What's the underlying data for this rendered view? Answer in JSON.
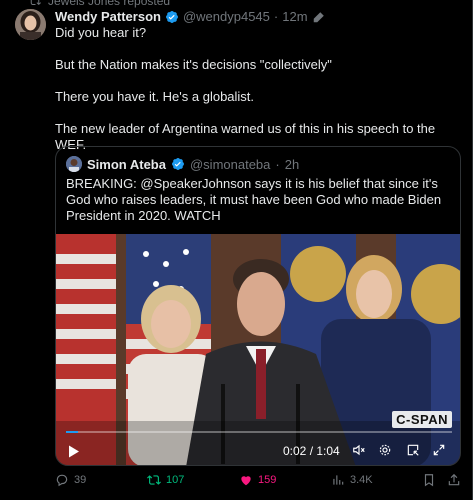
{
  "repost": {
    "label": "Jewels Jones reposted"
  },
  "tweet": {
    "name": "Wendy Patterson",
    "handle": "@wendyp4545",
    "dot": "·",
    "time": "12m",
    "paragraphs": [
      "Did you hear it?",
      "But the Nation makes it's decisions \"collectively\"",
      "There you have it. He's a globalist.",
      "The new leader of Argentina warned us of this in his speech to the WEF."
    ]
  },
  "quote": {
    "name": "Simon Ateba",
    "handle": "@simonateba",
    "dot": "·",
    "time": "2h",
    "text": "BREAKING: @SpeakerJohnson says it is his belief that since it's God who raises leaders, it must have been God who made Biden President in 2020. WATCH",
    "video": {
      "watermark": "C-SPAN",
      "time_display": "0:02 / 1:04",
      "progress": 0.03
    }
  },
  "actions": {
    "replies": "39",
    "reposts": "107",
    "likes": "159",
    "views": "3.4K"
  },
  "colors": {
    "accent": "#1d9bf0",
    "repost_active": "#00ba7c",
    "like_active": "#f91880",
    "muted": "#71767b"
  }
}
